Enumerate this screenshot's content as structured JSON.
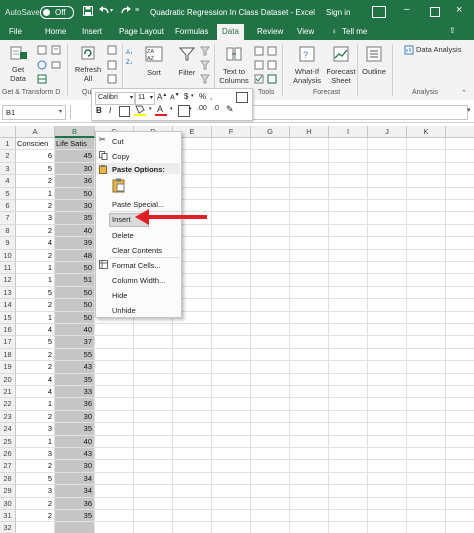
{
  "titlebar": {
    "autosave": "AutoSave",
    "autosave_state": "Off",
    "title": "Quadratic Regression In Class Dataset  -  Excel",
    "signin": "Sign in"
  },
  "tabs": [
    {
      "label": "File"
    },
    {
      "label": "Home"
    },
    {
      "label": "Insert"
    },
    {
      "label": "Page Layout"
    },
    {
      "label": "Formulas"
    },
    {
      "label": "Data"
    },
    {
      "label": "Review"
    },
    {
      "label": "View"
    }
  ],
  "tell_me": "Tell me",
  "ribbon": {
    "get_data_1": "Get",
    "get_data_2": "Data",
    "refresh_1": "Refresh",
    "refresh_2": "All",
    "sort": "Sort",
    "filter": "Filter",
    "text_to_columns_1": "Text to",
    "text_to_columns_2": "Columns",
    "whatif_1": "What-If",
    "whatif_2": "Analysis",
    "forecast_1": "Forecast",
    "forecast_2": "Sheet",
    "outline": "Outline",
    "data_analysis": "Data Analysis",
    "groups": {
      "get_transform": "Get & Transform D",
      "queries": "Querie",
      "data_tools": "Tools",
      "forecast": "Forecast",
      "analysis": "Analysis"
    }
  },
  "formula_bar": {
    "name_box": "B1"
  },
  "mini_toolbar": {
    "font": "Calibri",
    "size": "11",
    "currency": "$",
    "percent": "%"
  },
  "columns": [
    "A",
    "B",
    "C",
    "D",
    "E",
    "F",
    "G",
    "H",
    "I",
    "J",
    "K"
  ],
  "rows": [
    "1",
    "2",
    "3",
    "4",
    "5",
    "6",
    "7",
    "8",
    "9",
    "10",
    "11",
    "12",
    "13",
    "14",
    "15",
    "16",
    "17",
    "18",
    "19",
    "20",
    "21",
    "22",
    "23",
    "24",
    "25",
    "26",
    "27",
    "28",
    "29",
    "30",
    "31",
    "32"
  ],
  "col_a_values": [
    "Conscien",
    "6",
    "5",
    "2",
    "1",
    "2",
    "3",
    "2",
    "4",
    "2",
    "1",
    "1",
    "5",
    "2",
    "1",
    "4",
    "5",
    "2",
    "2",
    "4",
    "4",
    "1",
    "2",
    "3",
    "1",
    "3",
    "2",
    "5",
    "3",
    "2",
    "2",
    ""
  ],
  "col_b_values": [
    "Life Satis",
    "45",
    "30",
    "36",
    "50",
    "30",
    "35",
    "40",
    "39",
    "48",
    "50",
    "51",
    "50",
    "50",
    "50",
    "40",
    "37",
    "55",
    "43",
    "35",
    "33",
    "36",
    "30",
    "35",
    "40",
    "43",
    "30",
    "34",
    "34",
    "36",
    "35",
    ""
  ],
  "context_menu": {
    "cut": "Cut",
    "copy": "Copy",
    "paste_options": "Paste Options:",
    "paste_special": "Paste Special...",
    "insert": "Insert",
    "delete": "Delete",
    "clear_contents": "Clear Contents",
    "format_cells": "Format Cells...",
    "column_width": "Column Width...",
    "hide": "Hide",
    "unhide": "Unhide"
  },
  "colors": {
    "excel_green": "#217346",
    "selection": "#c6c6c6",
    "arrow": "#e31e24"
  }
}
